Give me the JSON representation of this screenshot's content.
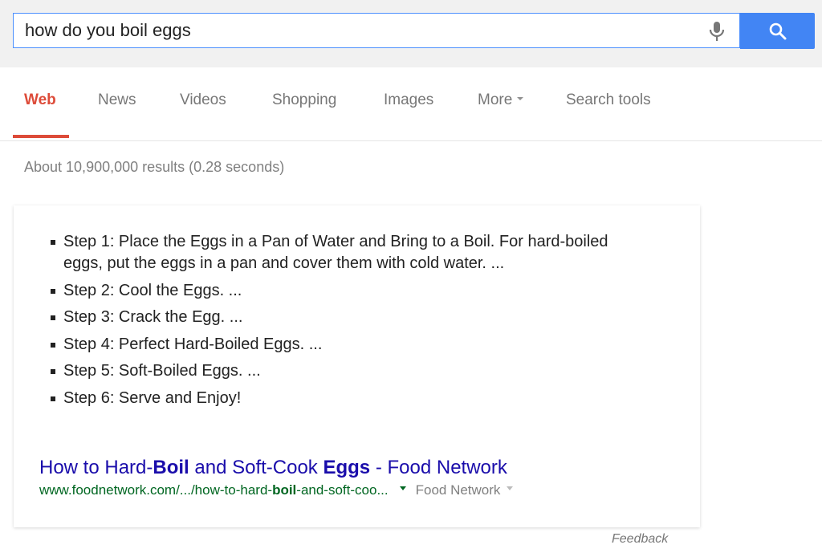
{
  "search": {
    "query": "how do you boil eggs",
    "mic_icon": "microphone-icon",
    "search_icon": "magnifier-icon",
    "accent_color": "#4285f4"
  },
  "tabs": [
    {
      "label": "Web",
      "active": true
    },
    {
      "label": "News"
    },
    {
      "label": "Videos"
    },
    {
      "label": "Shopping"
    },
    {
      "label": "Images"
    },
    {
      "label": "More",
      "has_dropdown": true
    },
    {
      "label": "Search tools"
    }
  ],
  "tab_active_color": "#dd4b39",
  "stats": "About 10,900,000 results (0.28 seconds)",
  "featured_snippet": {
    "steps": [
      "Step 1: Place the Eggs in a Pan of Water and Bring to a Boil. For hard-boiled eggs, put the eggs in a pan and cover them with cold water. ...",
      "Step 2: Cool the Eggs. ...",
      "Step 3: Crack the Egg. ...",
      "Step 4: Perfect Hard-Boiled Eggs. ...",
      "Step 5: Soft-Boiled Eggs. ...",
      "Step 6: Serve and Enjoy!"
    ],
    "result": {
      "title_parts": [
        {
          "text": "How to Hard-",
          "bold": false
        },
        {
          "text": "Boil",
          "bold": true
        },
        {
          "text": " and Soft-Cook ",
          "bold": false
        },
        {
          "text": "Eggs",
          "bold": true
        },
        {
          "text": " - Food Network",
          "bold": false
        }
      ],
      "url_parts": [
        {
          "text": "www.foodnetwork.com/.../how-to-hard-",
          "bold": false
        },
        {
          "text": "boil",
          "bold": true
        },
        {
          "text": "-and-soft-coo...",
          "bold": false
        }
      ],
      "source": "Food Network",
      "title_color": "#1a0dab",
      "url_color": "#006621"
    }
  },
  "feedback_label": "Feedback"
}
